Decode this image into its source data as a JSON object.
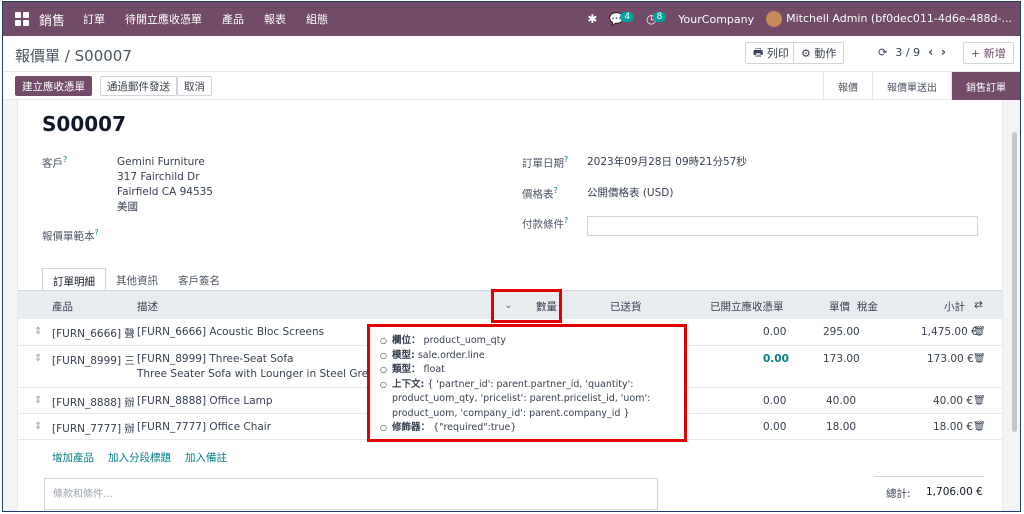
{
  "navbar": {
    "app_name": "銷售",
    "menus": [
      "訂單",
      "待開立應收憑單",
      "產品",
      "報表",
      "組態"
    ],
    "messages_count": "4",
    "activities_count": "8",
    "company": "YourCompany",
    "user": "Mitchell Admin (bf0dec011-4d6e-488d-..."
  },
  "breadcrumb": {
    "parent": "報價單",
    "current": "S00007"
  },
  "control": {
    "print": "列印",
    "action": "動作",
    "pager": "3 / 9",
    "new": "新增"
  },
  "statusbar": {
    "buttons": [
      "建立應收憑單",
      "通過郵件發送",
      "取消"
    ],
    "stages": [
      "報價",
      "報價單送出",
      "銷售訂單"
    ]
  },
  "form": {
    "order_name": "S00007",
    "customer_label": "客戶",
    "customer_lines": [
      "Gemini Furniture",
      "317 Fairchild Dr",
      "Fairfield CA 94535",
      "美國"
    ],
    "template_label": "報價單範本",
    "order_date_label": "訂單日期",
    "order_date": "2023年09月28日 09時21分57秒",
    "pricelist_label": "價格表",
    "pricelist": "公開價格表 (USD)",
    "payment_terms_label": "付款條件"
  },
  "tabs": [
    "訂單明細",
    "其他資訊",
    "客戶簽名"
  ],
  "table": {
    "headers": [
      "產品",
      "描述",
      "數量",
      "已送貨",
      "已開立應收憑單",
      "單價",
      "稅金",
      "小計"
    ],
    "rows": [
      {
        "product": "[FURN_6666] 聲...",
        "desc": "[FURN_6666] Acoustic Bloc Screens",
        "desc2": "",
        "invoiced": "0.00",
        "price": "295.00",
        "subtotal": "1,475.00 €"
      },
      {
        "product": "[FURN_8999] 三...",
        "desc": "[FURN_8999] Three-Seat Sofa",
        "desc2": "Three Seater Sofa with Lounger in Steel Grey Colour",
        "invoiced": "0.00",
        "price": "173.00",
        "subtotal": "173.00 €"
      },
      {
        "product": "[FURN_8888] 辦...",
        "desc": "[FURN_8888] Office Lamp",
        "desc2": "",
        "invoiced": "0.00",
        "price": "40.00",
        "subtotal": "40.00 €"
      },
      {
        "product": "[FURN_7777] 辦...",
        "desc": "[FURN_7777] Office Chair",
        "desc2": "",
        "invoiced": "0.00",
        "price": "18.00",
        "subtotal": "18.00 €"
      }
    ],
    "add_links": [
      "增加產品",
      "加入分段標題",
      "加入備註"
    ]
  },
  "terms_placeholder": "條款和條件...",
  "total": {
    "label": "總計:",
    "value": "1,706.00 €"
  },
  "tooltip": {
    "field_label": "欄位：",
    "field_value": "product_uom_qty",
    "model_label": "模型:",
    "model_value": "sale.order.line",
    "type_label": "類型：",
    "type_value": "float",
    "context_label": "上下文:",
    "context_value": "{ 'partner_id': parent.partner_id, 'quantity': product_uom_qty, 'pricelist': parent.pricelist_id, 'uom': product_uom, 'company_id': parent.company_id }",
    "modifier_label": "修飾器：",
    "modifier_value": "{\"required\":true}"
  },
  "colors": {
    "brand": "#714b67",
    "highlight": "#e00000",
    "link": "#017e84"
  }
}
